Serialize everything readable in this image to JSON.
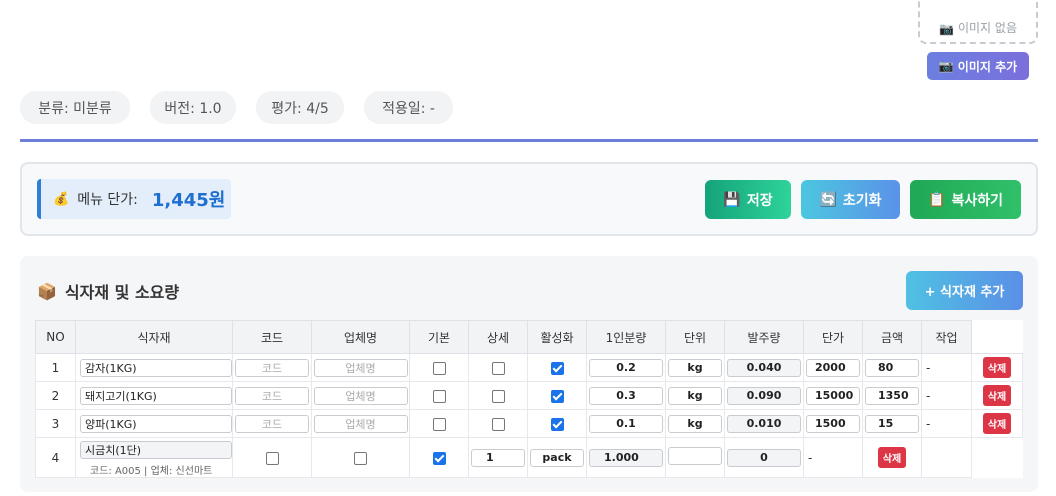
{
  "image": {
    "empty_label": "이미지 없음",
    "add_button": "이미지 추가"
  },
  "info_chips": [
    {
      "label": "분류: 미분류"
    },
    {
      "label": "버전: 1.0"
    },
    {
      "label": "평가: 4/5"
    },
    {
      "label": "적용일: -"
    }
  ],
  "cost": {
    "label": "메뉴 단가:",
    "value": "1,445원"
  },
  "actions": {
    "save": "저장",
    "reset": "초기화",
    "copy": "복사하기"
  },
  "ingredients_section": {
    "title": "식자재 및 소요량",
    "add_button": "+ 식자재 추가"
  },
  "table": {
    "headers": [
      "NO",
      "식자재",
      "코드",
      "업체명",
      "기본",
      "상세",
      "활성화",
      "1인분량",
      "단위",
      "발주량",
      "단가",
      "금액",
      "작업"
    ],
    "code_placeholder": "코드",
    "vendor_placeholder": "업체명",
    "delete_label": "삭제",
    "rows": [
      {
        "no": "1",
        "name": "감자(1KG)",
        "basic": false,
        "detail": false,
        "active": true,
        "portion": "0.2",
        "unit": "kg",
        "order": "0.040",
        "price": "2000",
        "amount": "80",
        "dash": "-"
      },
      {
        "no": "2",
        "name": "돼지고기(1KG)",
        "basic": false,
        "detail": false,
        "active": true,
        "portion": "0.3",
        "unit": "kg",
        "order": "0.090",
        "price": "15000",
        "amount": "1350",
        "dash": "-"
      },
      {
        "no": "3",
        "name": "양파(1KG)",
        "basic": false,
        "detail": false,
        "active": true,
        "portion": "0.1",
        "unit": "kg",
        "order": "0.010",
        "price": "1500",
        "amount": "15",
        "dash": "-"
      }
    ],
    "row4": {
      "no": "4",
      "name": "시금치(1단)",
      "sub": "코드: A005 | 업체: 신선마트",
      "basic": false,
      "detail": false,
      "active": true,
      "portion": "1",
      "unit": "pack",
      "order": "1.000",
      "price": "",
      "amount": "0",
      "dash": "-"
    }
  },
  "colors": {
    "accent": "#6c7fd8",
    "cost_value": "#1e6fd0",
    "save": "#1aaa7a",
    "reset": "#4fb8e3",
    "copy": "#22ad58",
    "delete": "#dc3545"
  }
}
